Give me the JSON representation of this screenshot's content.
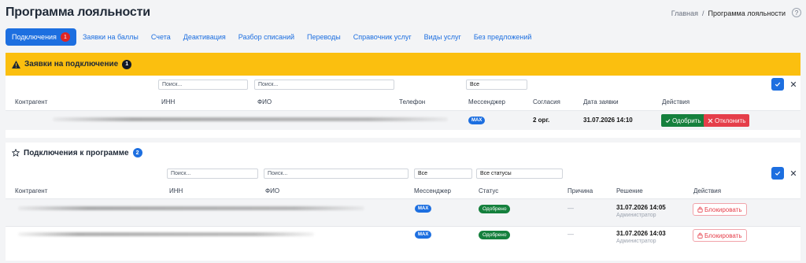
{
  "header": {
    "title": "Программа лояльности"
  },
  "breadcrumb": {
    "home": "Главная",
    "separator": "/",
    "current": "Программа лояльности"
  },
  "help_label": "?",
  "tabs": [
    {
      "label": "Подключения",
      "count": "1"
    },
    {
      "label": "Заявки на баллы"
    },
    {
      "label": "Счета"
    },
    {
      "label": "Деактивация"
    },
    {
      "label": "Разбор списаний"
    },
    {
      "label": "Переводы"
    },
    {
      "label": "Справочник услуг"
    },
    {
      "label": "Виды услуг"
    },
    {
      "label": "Без предложений"
    }
  ],
  "requests": {
    "title": "Заявки на подключение",
    "count": "1",
    "filters": {
      "inn_placeholder": "Поиск...",
      "fio_placeholder": "Поиск...",
      "messenger_value": "Все"
    },
    "columns": [
      "Контрагент",
      "ИНН",
      "ФИО",
      "Телефон",
      "Мессенджер",
      "Согласия",
      "Дата заявки",
      "Действия"
    ],
    "rows": [
      {
        "messenger": "MAX",
        "consents": "2 орг.",
        "date": "31.07.2026 14:10",
        "approve": "Одобрить",
        "reject": "Отклонить"
      }
    ]
  },
  "connections": {
    "title": "Подключения к программе",
    "count": "2",
    "filters": {
      "inn_placeholder": "Поиск...",
      "fio_placeholder": "Поиск...",
      "messenger_value": "Все",
      "status_value": "Все статусы"
    },
    "columns": [
      "Контрагент",
      "ИНН",
      "ФИО",
      "Мессенджер",
      "Статус",
      "Причина",
      "Решение",
      "Действия"
    ],
    "rows": [
      {
        "messenger": "MAX",
        "status": "Одобрено",
        "reason": "—",
        "decision_date": "31.07.2026 14:05",
        "decision_by": "Администратор",
        "action": "Блокировать"
      },
      {
        "messenger": "MAX",
        "status": "Одобрено",
        "reason": "—",
        "decision_date": "31.07.2026 14:03",
        "decision_by": "Администратор",
        "action": "Блокировать"
      }
    ]
  },
  "icons": {
    "ok": "check-icon",
    "close": "close-icon",
    "warning": "warning-icon",
    "star": "star-icon",
    "lock": "lock-icon"
  },
  "colors": {
    "accent": "#1d6fe0",
    "warning_header": "#fbbf0f",
    "success": "#15803d",
    "danger": "#e53e4a"
  }
}
